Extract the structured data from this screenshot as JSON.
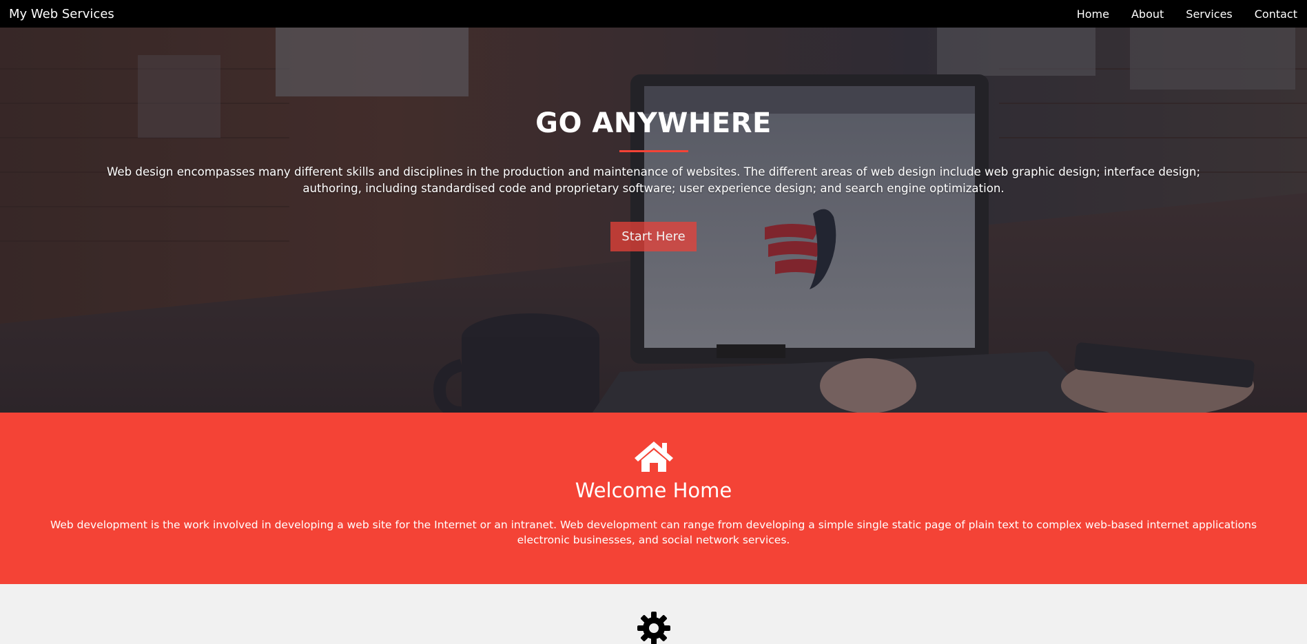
{
  "navbar": {
    "brand": "My Web Services",
    "links": [
      "Home",
      "About",
      "Services",
      "Contact"
    ]
  },
  "hero": {
    "title": "GO ANYWHERE",
    "text": "Web design encompasses many different skills and disciplines in the production and maintenance of websites. The different areas of web design include web graphic design; interface design; authoring, including standardised code and proprietary software; user experience design; and search engine optimization.",
    "button_label": "Start Here",
    "background_icon": "laptop-workspace-photo"
  },
  "welcome": {
    "icon": "home-icon",
    "title": "Welcome Home",
    "text": "Web development is the work involved in developing a web site for the Internet or an intranet. Web development can range from developing a simple single static page of plain text to complex web-based internet applications electronic businesses, and social network services."
  },
  "services": {
    "icon": "gear-icon"
  },
  "colors": {
    "accent": "#f44336",
    "navbar": "#000000",
    "light_section": "#f1f1f1"
  }
}
